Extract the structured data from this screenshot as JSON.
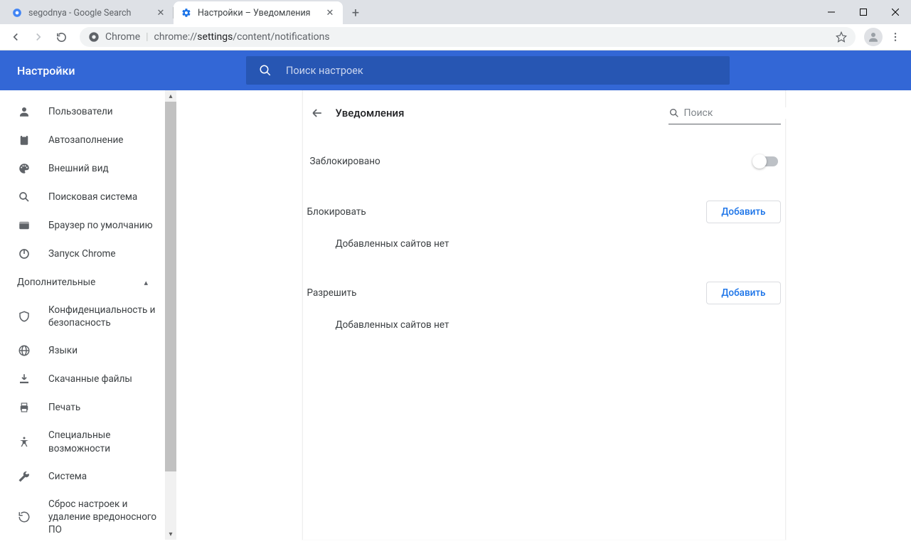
{
  "tabs": [
    {
      "title": "segodnya - Google Search",
      "active": false
    },
    {
      "title": "Настройки – Уведомления",
      "active": true
    }
  ],
  "urlbar": {
    "chrome_label": "Chrome",
    "prefix": "chrome://",
    "bold": "settings",
    "rest": "/content/notifications"
  },
  "header": {
    "title": "Настройки",
    "search_placeholder": "Поиск настроек"
  },
  "sidebar": {
    "items_top": [
      {
        "icon": "person",
        "label": "Пользователи"
      },
      {
        "icon": "clipboard",
        "label": "Автозаполнение"
      },
      {
        "icon": "palette",
        "label": "Внешний вид"
      },
      {
        "icon": "search",
        "label": "Поисковая система"
      },
      {
        "icon": "browser",
        "label": "Браузер по умолчанию"
      },
      {
        "icon": "power",
        "label": "Запуск Chrome"
      }
    ],
    "advanced_label": "Дополнительные",
    "items_bottom": [
      {
        "icon": "shield",
        "label": "Конфиденциальность и безопасность"
      },
      {
        "icon": "globe",
        "label": "Языки"
      },
      {
        "icon": "download",
        "label": "Скачанные файлы"
      },
      {
        "icon": "print",
        "label": "Печать"
      },
      {
        "icon": "accessibility",
        "label": "Специальные возможности"
      },
      {
        "icon": "wrench",
        "label": "Система"
      },
      {
        "icon": "restore",
        "label": "Сброс настроек и удаление вредоносного ПО"
      }
    ]
  },
  "panel": {
    "title": "Уведомления",
    "filter_placeholder": "Поиск",
    "blocked_label": "Заблокировано",
    "block_section": "Блокировать",
    "allow_section": "Разрешить",
    "add_button": "Добавить",
    "empty_text": "Добавленных сайтов нет"
  }
}
